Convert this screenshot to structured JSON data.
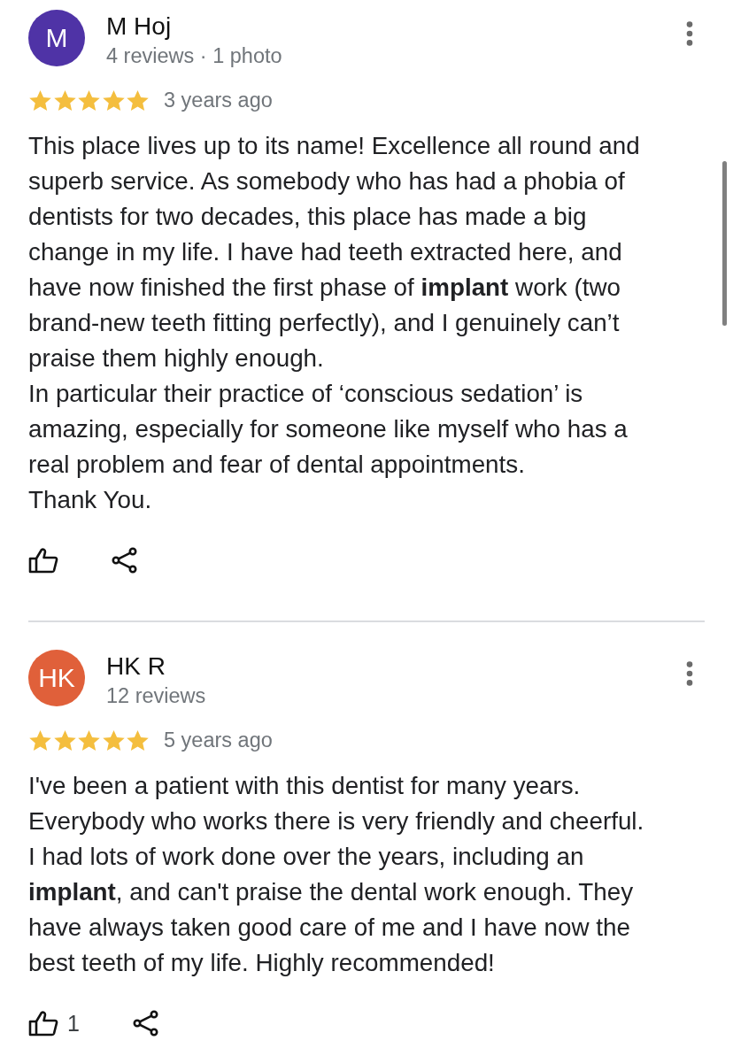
{
  "reviews": [
    {
      "author": "M Hoj",
      "initials": "M",
      "color": "#4f33a6",
      "meta": "4 reviews · 1 photo",
      "stars": 5,
      "time": "3 years ago",
      "text": "This place lives up to its name! Excellence all round and superb service. As somebody who has had a phobia of dentists for two decades, this place has made a big change in my life. I have had teeth extracted here, and have now finished the first phase of **implant** work (two brand-new teeth fitting perfectly), and I genuinely can’t praise them highly enough.\nIn particular their practice of ‘conscious sedation’ is amazing, especially for someone like myself who has a real problem and fear of dental appointments.\nThank You."
    },
    {
      "author": "HK R",
      "initials": "HK",
      "color": "#e0603a",
      "meta": "12 reviews",
      "stars": 5,
      "time": "5 years ago",
      "text": "I've been a patient with this dentist for many years. Everybody who works there is very friendly and cheerful. I had lots of work done over the years, including an **implant**, and can't praise the dental work enough. They have always taken good care of me and I have now the best teeth of my life. Highly recommended!",
      "likes": "1"
    }
  ]
}
